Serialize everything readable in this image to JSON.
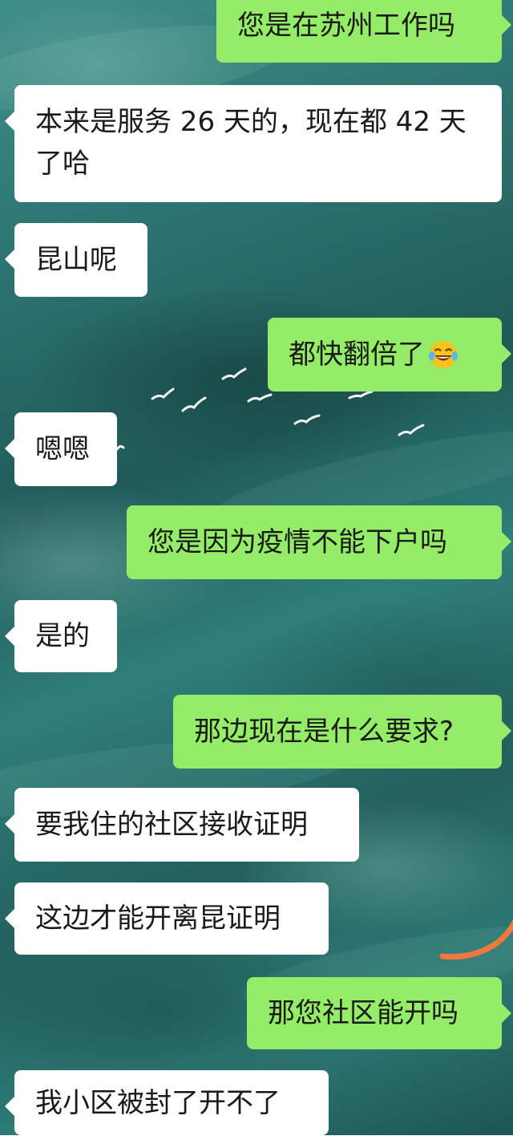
{
  "chat": {
    "messages": [
      {
        "side": "out",
        "text": "您是在苏州工作吗"
      },
      {
        "side": "in",
        "text": "本来是服务 26 天的，现在都 42 天了哈"
      },
      {
        "side": "in",
        "text": "昆山呢"
      },
      {
        "side": "out",
        "text": "都快翻倍了",
        "emoji": "laughing-crying-emoji"
      },
      {
        "side": "in",
        "text": "嗯嗯"
      },
      {
        "side": "out",
        "text": "您是因为疫情不能下户吗"
      },
      {
        "side": "in",
        "text": "是的"
      },
      {
        "side": "out",
        "text": "那边现在是什么要求?"
      },
      {
        "side": "in",
        "text": "要我住的社区接收证明"
      },
      {
        "side": "in",
        "text": "这边才能开离昆证明"
      },
      {
        "side": "out",
        "text": "那您社区能开吗"
      },
      {
        "side": "in",
        "text": "我小区被封了开不了"
      }
    ]
  },
  "colors": {
    "incoming_bubble": "#ffffff",
    "outgoing_bubble": "#95ec69",
    "annotation_stroke": "#f07a3c"
  }
}
